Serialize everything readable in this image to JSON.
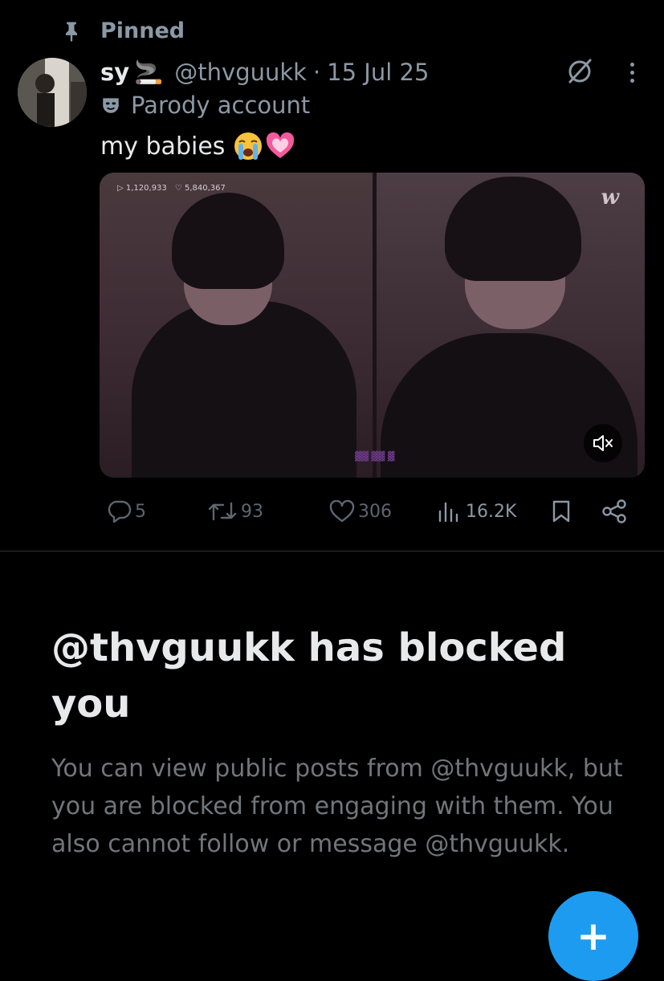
{
  "pinned": {
    "label": "Pinned",
    "icon": "pin-icon"
  },
  "tweet": {
    "display_name": "sy",
    "name_emoji": "🚬",
    "handle": "@thvguukk",
    "separator": "·",
    "date": "15 Jul 25",
    "parody_label": "Parody account",
    "text": "my babies",
    "text_emojis": [
      "loudly-crying-face",
      "growing-heart"
    ],
    "media": {
      "stats_plays": "1,120,933",
      "stats_likes": "5,840,367",
      "logo": "w",
      "muted": true
    },
    "actions": {
      "replies": "5",
      "reposts": "93",
      "likes": "306",
      "views": "16.2K"
    }
  },
  "blocked": {
    "heading": "@thvguukk has blocked you",
    "body": "You can view public posts from @thvguukk, but you are blocked from engaging with them. You also cannot follow or message @thvguukk."
  },
  "fab": {
    "label": "+",
    "color": "#1d9bf0"
  },
  "colors": {
    "background": "#000000",
    "text": "#e7e9ea",
    "muted": "#8b98a5",
    "accent": "#1d9bf0"
  }
}
